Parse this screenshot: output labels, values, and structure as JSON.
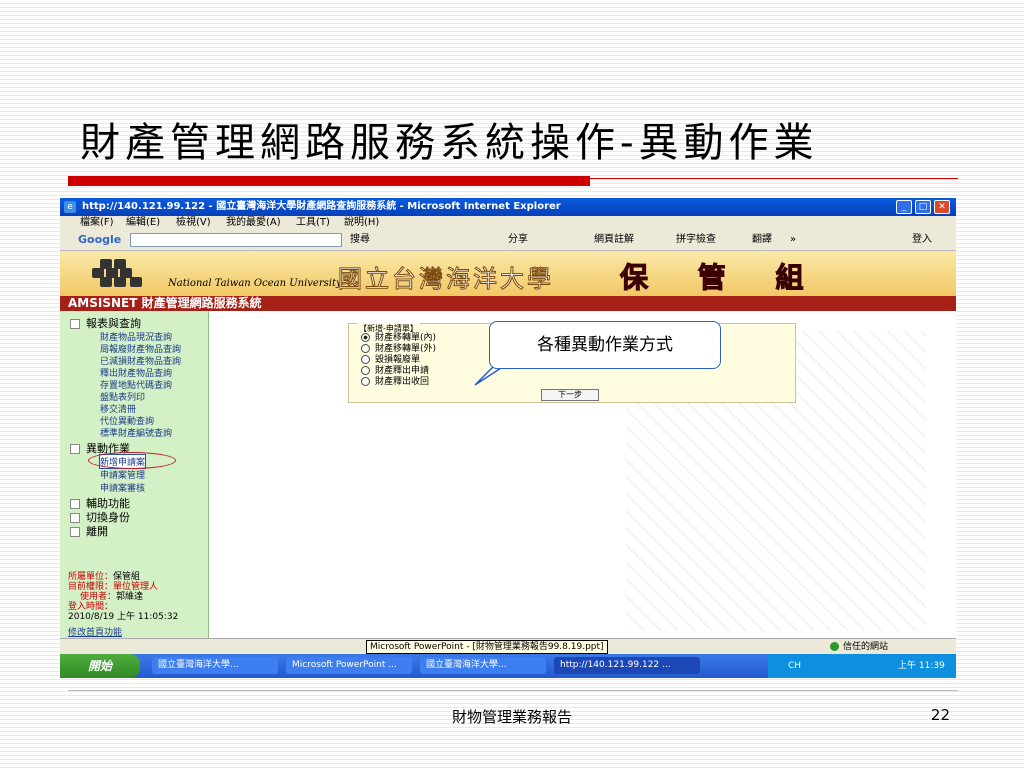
{
  "slide": {
    "title": "財產管理網路服務系統操作-異動作業",
    "footer": "財物管理業務報告",
    "page_number": "22"
  },
  "browser": {
    "window_title": "http://140.121.99.122 - 國立臺灣海洋大學財產網路查詢服務系統 - Microsoft Internet Explorer",
    "menu": [
      "檔案(F)",
      "編輯(E)",
      "檢視(V)",
      "我的最愛(A)",
      "工具(T)",
      "說明(H)"
    ],
    "toolbar": {
      "google": "Google",
      "search_btn": "搜尋",
      "share": "分享",
      "annotate": "網頁註解",
      "spell": "拼字檢查",
      "translate": "翻譯",
      "more": "»",
      "login": "登入"
    },
    "status": {
      "tooltip": "Microsoft PowerPoint - [財物管理業務報告99.8.19.ppt]",
      "zone": "信任的網站"
    },
    "taskbar": {
      "start": "開始",
      "tasks": [
        "國立臺灣海洋大學...",
        "Microsoft PowerPoint ...",
        "國立臺灣海洋大學...",
        "http://140.121.99.122 ..."
      ],
      "lang": "CH",
      "time": "上午 11:39"
    }
  },
  "site": {
    "university_en": "National Taiwan Ocean University",
    "university_zh": "國立台灣海洋大學",
    "unit": "保 管 組",
    "system_name": "AMSISNET 財產管理網路服務系統"
  },
  "sidebar": {
    "report_section": "報表與查詢",
    "report_items": [
      "財產物品現況查詢",
      "局報廢財產物品查詢",
      "已減損財產物品查詢",
      "釋出財產物品查詢",
      "存置地點代碼查詢",
      "盤點表列印",
      "移交清冊",
      "代位異動查詢",
      "標準財產編號查詢"
    ],
    "change_section": "異動作業",
    "change_items": [
      "新增申請案",
      "申請案管理",
      "申請案審核"
    ],
    "aux": "輔助功能",
    "switch": "切換身份",
    "leave": "離開",
    "info": {
      "dept_label": "所屬單位：",
      "dept": "保管組",
      "perm_label": "目前權限：",
      "perm": "單位管理人",
      "user_label": "使用者：",
      "user": "郭維達",
      "login_label": "登入時間：",
      "login_time": "2010/8/19 上午 11:05:32",
      "modify_link": "修改首頁功能"
    }
  },
  "form": {
    "legend": "【新增-申請單】",
    "options": [
      "財產移轉單(內)",
      "財產移轉單(外)",
      "毀損報廢單",
      "財產釋出申請",
      "財產釋出收回"
    ],
    "selected": "財產移轉單(內)",
    "next_button": "下一步"
  },
  "callout": "各種異動作業方式",
  "colors": {
    "title_accent": "#cc0000",
    "site_header_bar": "#a52017",
    "sidebar_bg": "#d4f0c6",
    "callout_border": "#2860c8"
  }
}
